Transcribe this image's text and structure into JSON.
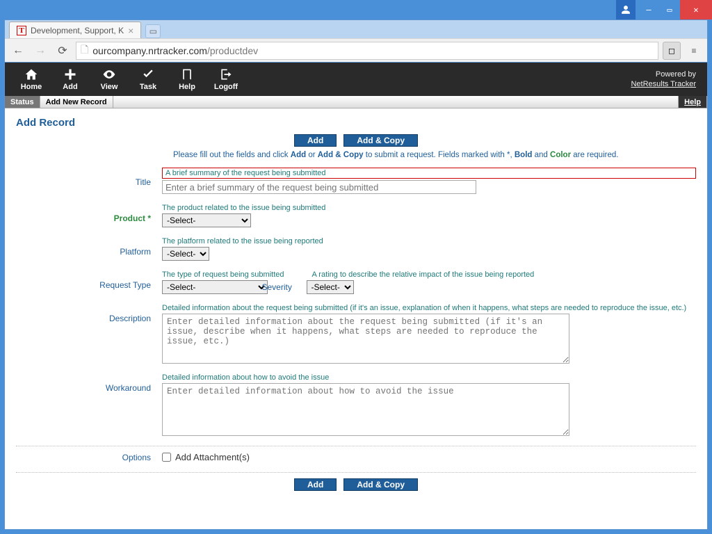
{
  "window": {
    "tab_title": "Development, Support, K",
    "url_host": "ourcompany.nrtracker.com",
    "url_path": "/productdev"
  },
  "iconbar": {
    "home": "Home",
    "add": "Add",
    "view": "View",
    "task": "Task",
    "help": "Help",
    "logoff": "Logoff",
    "powered_by": "Powered by",
    "powered_link": "NetResults Tracker"
  },
  "crumbs": {
    "status": "Status",
    "active": "Add New Record",
    "help": "Help"
  },
  "page": {
    "title": "Add Record",
    "add_btn": "Add",
    "add_copy_btn": "Add & Copy",
    "intro_pre": "Please fill out the fields and click ",
    "intro_b1": "Add",
    "intro_mid1": " or ",
    "intro_b2": "Add & Copy",
    "intro_post1": " to submit a request. Fields marked with *, ",
    "intro_bold": "Bold",
    "intro_post2": " and ",
    "intro_color": "Color",
    "intro_post3": " are required."
  },
  "fields": {
    "title": {
      "label": "Title",
      "help": "A brief summary of the request being submitted",
      "placeholder": "Enter a brief summary of the request being submitted"
    },
    "product": {
      "label": "Product *",
      "help": "The product related to the issue being submitted",
      "selected": "-Select-"
    },
    "platform": {
      "label": "Platform",
      "help": "The platform related to the issue being reported",
      "selected": "-Select-"
    },
    "request_type": {
      "label": "Request Type",
      "help": "The type of request being submitted",
      "selected": "-Select-"
    },
    "severity": {
      "label": "Severity",
      "help": "A rating to describe the relative impact of the issue being reported",
      "selected": "-Select-"
    },
    "description": {
      "label": "Description",
      "help": "Detailed information about the request being submitted (if it's an issue, explanation of when it happens, what steps are needed to reproduce the issue, etc.)",
      "placeholder": "Enter detailed information about the request being submitted (if it's an issue, describe when it happens, what steps are needed to reproduce the issue, etc.)"
    },
    "workaround": {
      "label": "Workaround",
      "help": "Detailed information about how to avoid the issue",
      "placeholder": "Enter detailed information about how to avoid the issue"
    },
    "options": {
      "label": "Options",
      "attach": "Add Attachment(s)"
    }
  }
}
